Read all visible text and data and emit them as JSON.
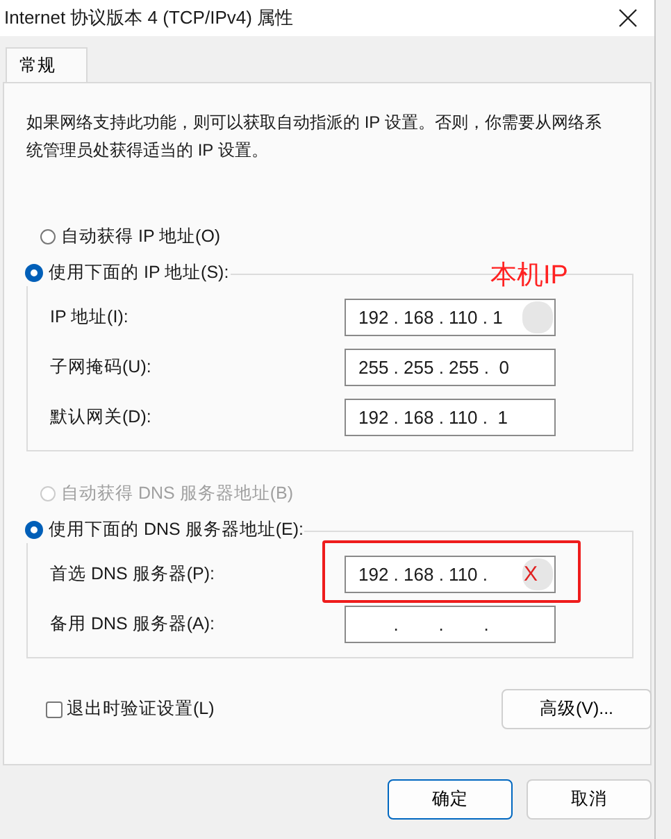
{
  "window": {
    "title": "Internet 协议版本 4 (TCP/IPv4) 属性"
  },
  "tabs": [
    {
      "label": "常规",
      "selected": true
    }
  ],
  "description": "如果网络支持此功能，则可以获取自动指派的 IP 设置。否则，你需要从网络系统管理员处获得适当的 IP 设置。",
  "ip": {
    "auto_radio": {
      "label": "自动获得 IP 地址(O)",
      "selected": false,
      "disabled": false
    },
    "manual_radio": {
      "label": "使用下面的 IP 地址(S):",
      "selected": true,
      "disabled": false
    },
    "fields": [
      {
        "label": "IP 地址(I):",
        "value": "192 . 168 . 110 . 1",
        "note": "本机IP",
        "redacted": true
      },
      {
        "label": "子网掩码(U):",
        "value": "255 . 255 . 255 .  0"
      },
      {
        "label": "默认网关(D):",
        "value": "192 . 168 . 110 .  1"
      }
    ]
  },
  "dns": {
    "auto_radio": {
      "label": "自动获得 DNS 服务器地址(B)",
      "selected": false,
      "disabled": true
    },
    "manual_radio": {
      "label": "使用下面的 DNS 服务器地址(E):",
      "selected": true,
      "disabled": false
    },
    "fields": [
      {
        "label": "首选 DNS 服务器(P):",
        "value": "192 . 168 . 110 .",
        "mark": "X",
        "redacted": true,
        "highlighted": true
      },
      {
        "label": "备用 DNS 服务器(A):",
        "value": "       .        .        ."
      }
    ]
  },
  "validate_checkbox": {
    "label": "退出时验证设置(L)",
    "checked": false
  },
  "advanced_button": "高级(V)...",
  "buttons": [
    {
      "label": "确定",
      "default": true
    },
    {
      "label": "取消",
      "default": false
    }
  ]
}
